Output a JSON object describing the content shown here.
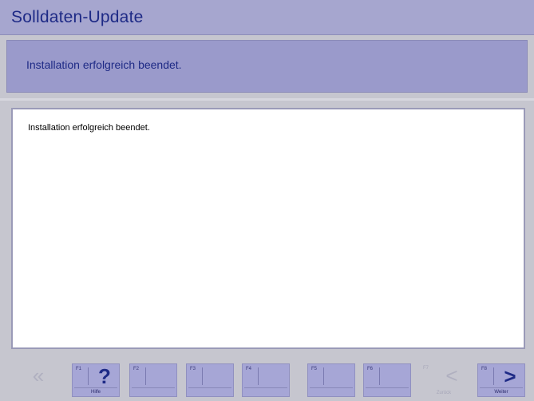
{
  "window": {
    "title": "Solldaten-Update"
  },
  "status": {
    "message": "Installation erfolgreich beendet."
  },
  "content": {
    "text": "Installation erfolgreich beendet."
  },
  "toolbar": {
    "keys": [
      {
        "key": "",
        "label": "",
        "glyph": "«",
        "icon": "double-chevron-left-icon",
        "enabled": false
      },
      {
        "key": "F1",
        "label": "Hilfe",
        "glyph": "?",
        "icon": "help-icon",
        "enabled": true
      },
      {
        "key": "F2",
        "label": "",
        "glyph": "",
        "icon": "",
        "enabled": true
      },
      {
        "key": "F3",
        "label": "",
        "glyph": "",
        "icon": "",
        "enabled": true
      },
      {
        "key": "F4",
        "label": "",
        "glyph": "",
        "icon": "",
        "enabled": true
      },
      {
        "key": "F5",
        "label": "",
        "glyph": "",
        "icon": "",
        "enabled": true
      },
      {
        "key": "F6",
        "label": "",
        "glyph": "",
        "icon": "",
        "enabled": true
      },
      {
        "key": "F7",
        "label": "Zurück",
        "glyph": "<",
        "icon": "chevron-left-icon",
        "enabled": false
      },
      {
        "key": "F8",
        "label": "Weiter",
        "glyph": ">",
        "icon": "chevron-right-icon",
        "enabled": true
      }
    ]
  }
}
